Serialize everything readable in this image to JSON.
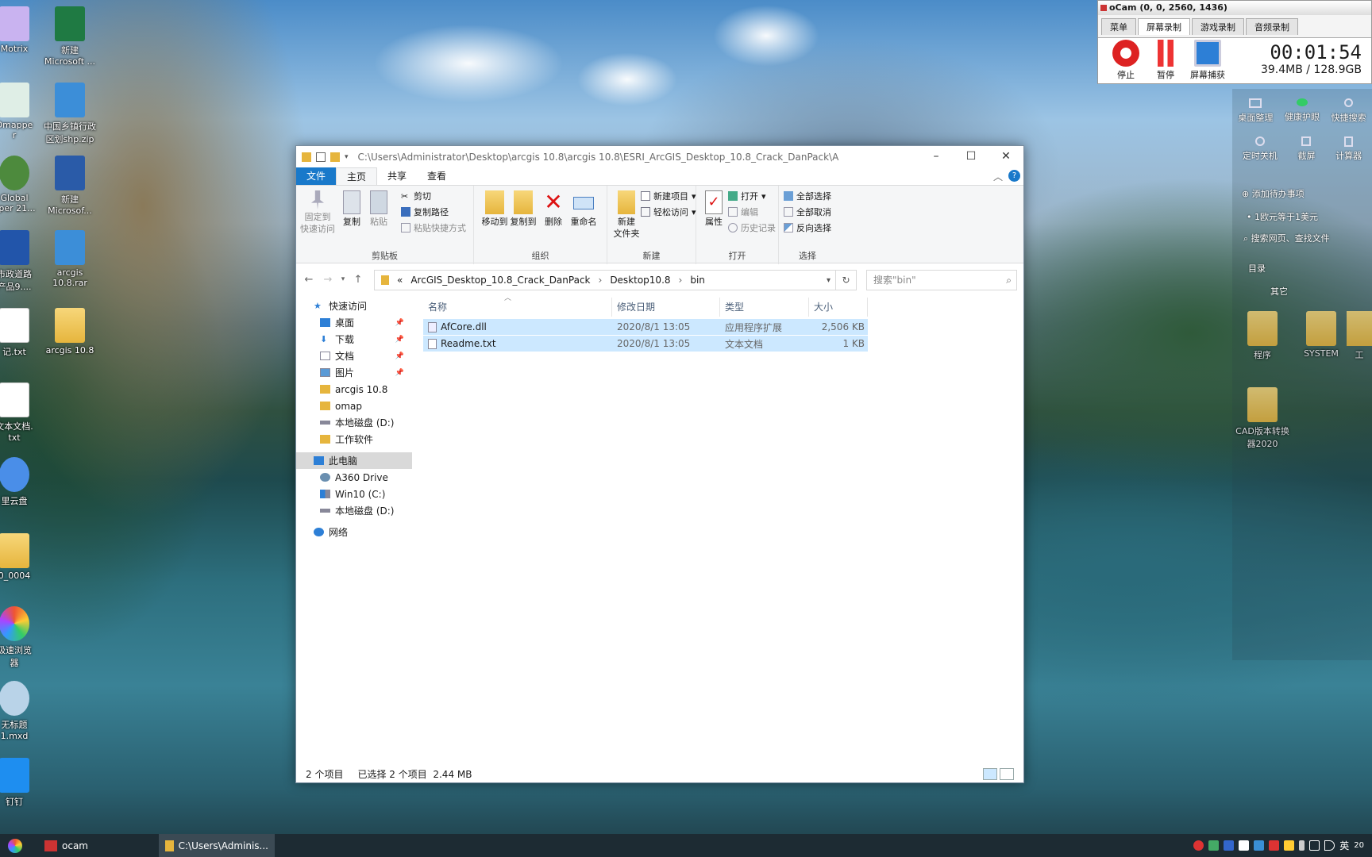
{
  "desktop": {
    "icons_left": [
      {
        "label": "Motrix"
      },
      {
        "label": "新建\nMicrosoft ..."
      },
      {
        "label": "Dmappe\nr"
      },
      {
        "label": "中国乡镇行政\n区划shp.zip"
      },
      {
        "label": "Global\npper 21..."
      },
      {
        "label": "新建\nMicrosof..."
      },
      {
        "label": "市政道路\n产品9...."
      },
      {
        "label": "arcgis\n10.8.rar"
      },
      {
        "label": "记.txt"
      },
      {
        "label": "arcgis 10.8"
      },
      {
        "label": "文本文档.\ntxt"
      },
      {
        "label": "里云盘"
      },
      {
        "label": "0_0004"
      },
      {
        "label": "极速浏览\n器"
      },
      {
        "label": "无标题\n1.mxd"
      },
      {
        "label": "钉钉"
      }
    ],
    "icons_right": [
      {
        "label": "程序"
      },
      {
        "label": "SYSTEM"
      },
      {
        "label": "工"
      },
      {
        "label": "CAD版本转换\n器2020"
      }
    ]
  },
  "side_widget": {
    "top_buttons": [
      "桌面整理",
      "健康护眼",
      "快捷搜索"
    ],
    "second_buttons": [
      "定时关机",
      "截屏",
      "计算器"
    ],
    "todo": "添加待办事项",
    "rate": "1欧元等于1美元",
    "search": "搜索网页、查找文件",
    "dir_label": "目录",
    "other_label": "其它"
  },
  "ocam": {
    "title": "oCam (0, 0, 2560, 1436)",
    "tabs": [
      "菜单",
      "屏幕录制",
      "游戏录制",
      "音频录制"
    ],
    "buttons": [
      "停止",
      "暂停",
      "屏幕捕获"
    ],
    "timer": "00:01:54",
    "size": "39.4MB / 128.9GB"
  },
  "explorer": {
    "title_path": "C:\\Users\\Administrator\\Desktop\\arcgis 10.8\\arcgis 10.8\\ESRI_ArcGIS_Desktop_10.8_Crack_DanPack\\A",
    "ribbon_tabs": [
      "文件",
      "主页",
      "共享",
      "查看"
    ],
    "clipboard": {
      "pin": "固定到\n快速访问",
      "copy": "复制",
      "paste": "粘贴",
      "cut": "剪切",
      "copy_path": "复制路径",
      "paste_shortcut": "粘贴快捷方式",
      "label": "剪贴板"
    },
    "organize": {
      "move_to": "移动到",
      "copy_to": "复制到",
      "delete": "删除",
      "rename": "重命名",
      "label": "组织"
    },
    "new": {
      "new_folder": "新建\n文件夹",
      "new_item": "新建项目",
      "easy_access": "轻松访问",
      "label": "新建"
    },
    "open": {
      "properties": "属性",
      "open": "打开",
      "edit": "编辑",
      "history": "历史记录",
      "label": "打开"
    },
    "select": {
      "select_all": "全部选择",
      "select_none": "全部取消",
      "invert": "反向选择",
      "label": "选择"
    },
    "breadcrumb": [
      "«",
      "ArcGIS_Desktop_10.8_Crack_DanPack",
      "Desktop10.8",
      "bin"
    ],
    "search_placeholder": "搜索\"bin\"",
    "nav": [
      {
        "label": "快速访问",
        "pinned": false
      },
      {
        "label": "桌面",
        "pinned": true
      },
      {
        "label": "下载",
        "pinned": true
      },
      {
        "label": "文档",
        "pinned": true
      },
      {
        "label": "图片",
        "pinned": true
      },
      {
        "label": "arcgis 10.8",
        "pinned": false
      },
      {
        "label": "omap",
        "pinned": false
      },
      {
        "label": "本地磁盘 (D:)",
        "pinned": false
      },
      {
        "label": "工作软件",
        "pinned": false
      },
      {
        "label": "此电脑",
        "pinned": false
      },
      {
        "label": "A360 Drive",
        "pinned": false
      },
      {
        "label": "Win10 (C:)",
        "pinned": false
      },
      {
        "label": "本地磁盘 (D:)",
        "pinned": false
      },
      {
        "label": "网络",
        "pinned": false
      }
    ],
    "columns": [
      "名称",
      "修改日期",
      "类型",
      "大小"
    ],
    "files": [
      {
        "name": "AfCore.dll",
        "date": "2020/8/1 13:05",
        "type": "应用程序扩展",
        "size": "2,506 KB"
      },
      {
        "name": "Readme.txt",
        "date": "2020/8/1 13:05",
        "type": "文本文档",
        "size": "1 KB"
      }
    ],
    "status": {
      "count": "2 个项目",
      "selected": "已选择 2 个项目",
      "size": "2.44 MB"
    },
    "colors": {
      "accent": "#1979ca",
      "selection": "#cce8ff"
    }
  },
  "taskbar": {
    "items": [
      "ocam",
      "C:\\Users\\Adminis..."
    ],
    "ime": "英",
    "clock_fragment": "20"
  }
}
